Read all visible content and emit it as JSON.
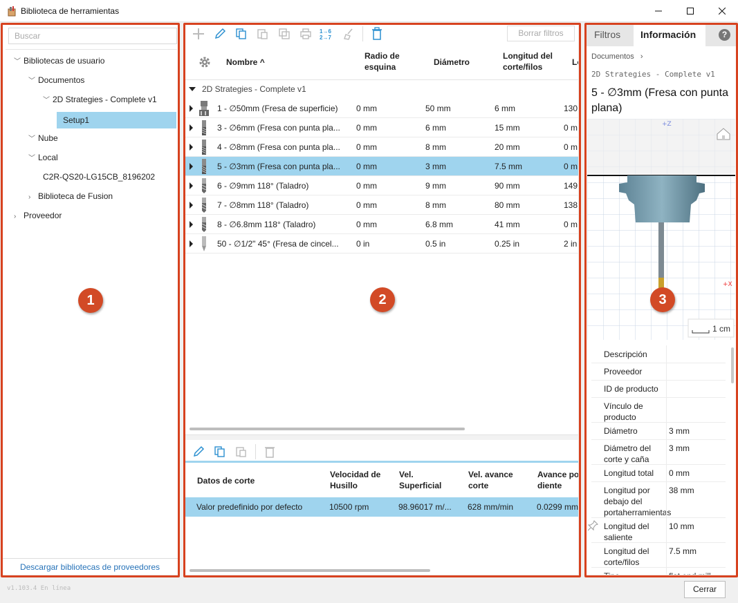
{
  "window": {
    "title": "Biblioteca de herramientas"
  },
  "left": {
    "search_placeholder": "Buscar",
    "tree": [
      {
        "label": "Bibliotecas de usuario",
        "chev": "v"
      },
      {
        "label": "Documentos",
        "chev": "v"
      },
      {
        "label": "2D Strategies - Complete v1",
        "chev": "v"
      },
      {
        "label": "Setup1",
        "chev": ""
      },
      {
        "label": "Nube",
        "chev": "v"
      },
      {
        "label": "Local",
        "chev": "v"
      },
      {
        "label": "C2R-QS20-LG15CB_8196202",
        "chev": ""
      },
      {
        "label": "Biblioteca de Fusion",
        "chev": ">"
      },
      {
        "label": "Proveedor",
        "chev": ">"
      }
    ],
    "footer_link": "Descargar bibliotecas de proveedores"
  },
  "center": {
    "clear_filters": "Borrar filtros",
    "columns": {
      "name": "Nombre",
      "radius": "Radio de esquina",
      "diameter": "Diámetro",
      "flute": "Longitud del corte/filos",
      "extra": "Lo"
    },
    "group": "2D Strategies - Complete v1",
    "rows": [
      {
        "name": "1 - ∅50mm (Fresa de superficie)",
        "radius": "0 mm",
        "diameter": "50 mm",
        "flute": "6 mm",
        "extra": "130",
        "tool": "face"
      },
      {
        "name": "3 - ∅6mm (Fresa con punta pla...",
        "radius": "0 mm",
        "diameter": "6 mm",
        "flute": "15 mm",
        "extra": "0 m",
        "tool": "endmill"
      },
      {
        "name": "4 - ∅8mm (Fresa con punta pla...",
        "radius": "0 mm",
        "diameter": "8 mm",
        "flute": "20 mm",
        "extra": "0 m",
        "tool": "endmill"
      },
      {
        "name": "5 - ∅3mm (Fresa con punta pla...",
        "radius": "0 mm",
        "diameter": "3 mm",
        "flute": "7.5 mm",
        "extra": "0 m",
        "tool": "endmill"
      },
      {
        "name": "6 - ∅9mm 118° (Taladro)",
        "radius": "0 mm",
        "diameter": "9 mm",
        "flute": "90 mm",
        "extra": "149",
        "tool": "drill"
      },
      {
        "name": "7 - ∅8mm 118° (Taladro)",
        "radius": "0 mm",
        "diameter": "8 mm",
        "flute": "80 mm",
        "extra": "138",
        "tool": "drill"
      },
      {
        "name": "8 - ∅6.8mm 118° (Taladro)",
        "radius": "0 mm",
        "diameter": "6.8 mm",
        "flute": "41 mm",
        "extra": "0 m",
        "tool": "drill"
      },
      {
        "name": "50 - ∅1/2\" 45° (Fresa de cincel...",
        "radius": "0 in",
        "diameter": "0.5 in",
        "flute": "0.25 in",
        "extra": "2 in",
        "tool": "chamfer"
      }
    ],
    "cut": {
      "headers": {
        "data": "Datos de corte",
        "spindle": "Velocidad de Husillo",
        "surface": "Vel. Superficial",
        "feed": "Vel. avance corte",
        "tooth": "Avance por diente"
      },
      "row": {
        "data": "Valor predefinido por defecto",
        "spindle": "10500 rpm",
        "surface": "98.96017 m/...",
        "feed": "628 mm/min",
        "tooth": "0.0299 mm"
      }
    }
  },
  "right": {
    "tabs": [
      "Filtros",
      "Información"
    ],
    "breadcrumb": "Documentos",
    "library": "2D Strategies - Complete v1",
    "tool_title": "5 - ∅3mm (Fresa con punta plana)",
    "axis_z": "+Z",
    "axis_x": "+X",
    "scale": "1 cm",
    "props": [
      {
        "label": "Descripción",
        "value": ""
      },
      {
        "label": "Proveedor",
        "value": ""
      },
      {
        "label": "ID de producto",
        "value": ""
      },
      {
        "label": "Vínculo de producto",
        "value": ""
      },
      {
        "label": "Diámetro",
        "value": "3 mm"
      },
      {
        "label": "Diámetro del corte y caña",
        "value": "3 mm"
      },
      {
        "label": "Longitud total",
        "value": "0 mm"
      },
      {
        "label": "Longitud por debajo del portaherramientas",
        "value": "38 mm"
      },
      {
        "label": "Longitud del saliente",
        "value": "10 mm"
      },
      {
        "label": "Longitud del corte/filos",
        "value": "7.5 mm"
      },
      {
        "label": "Tipo",
        "value": "flat end mill"
      }
    ]
  },
  "badges": [
    "1",
    "2",
    "3"
  ],
  "status": {
    "version": "v1.103.4 En línea",
    "close": "Cerrar"
  },
  "colors": {
    "accent": "#2672b8",
    "selection": "#9fd4ee",
    "highlight_box": "#d7421f",
    "badge": "#d24a26"
  }
}
